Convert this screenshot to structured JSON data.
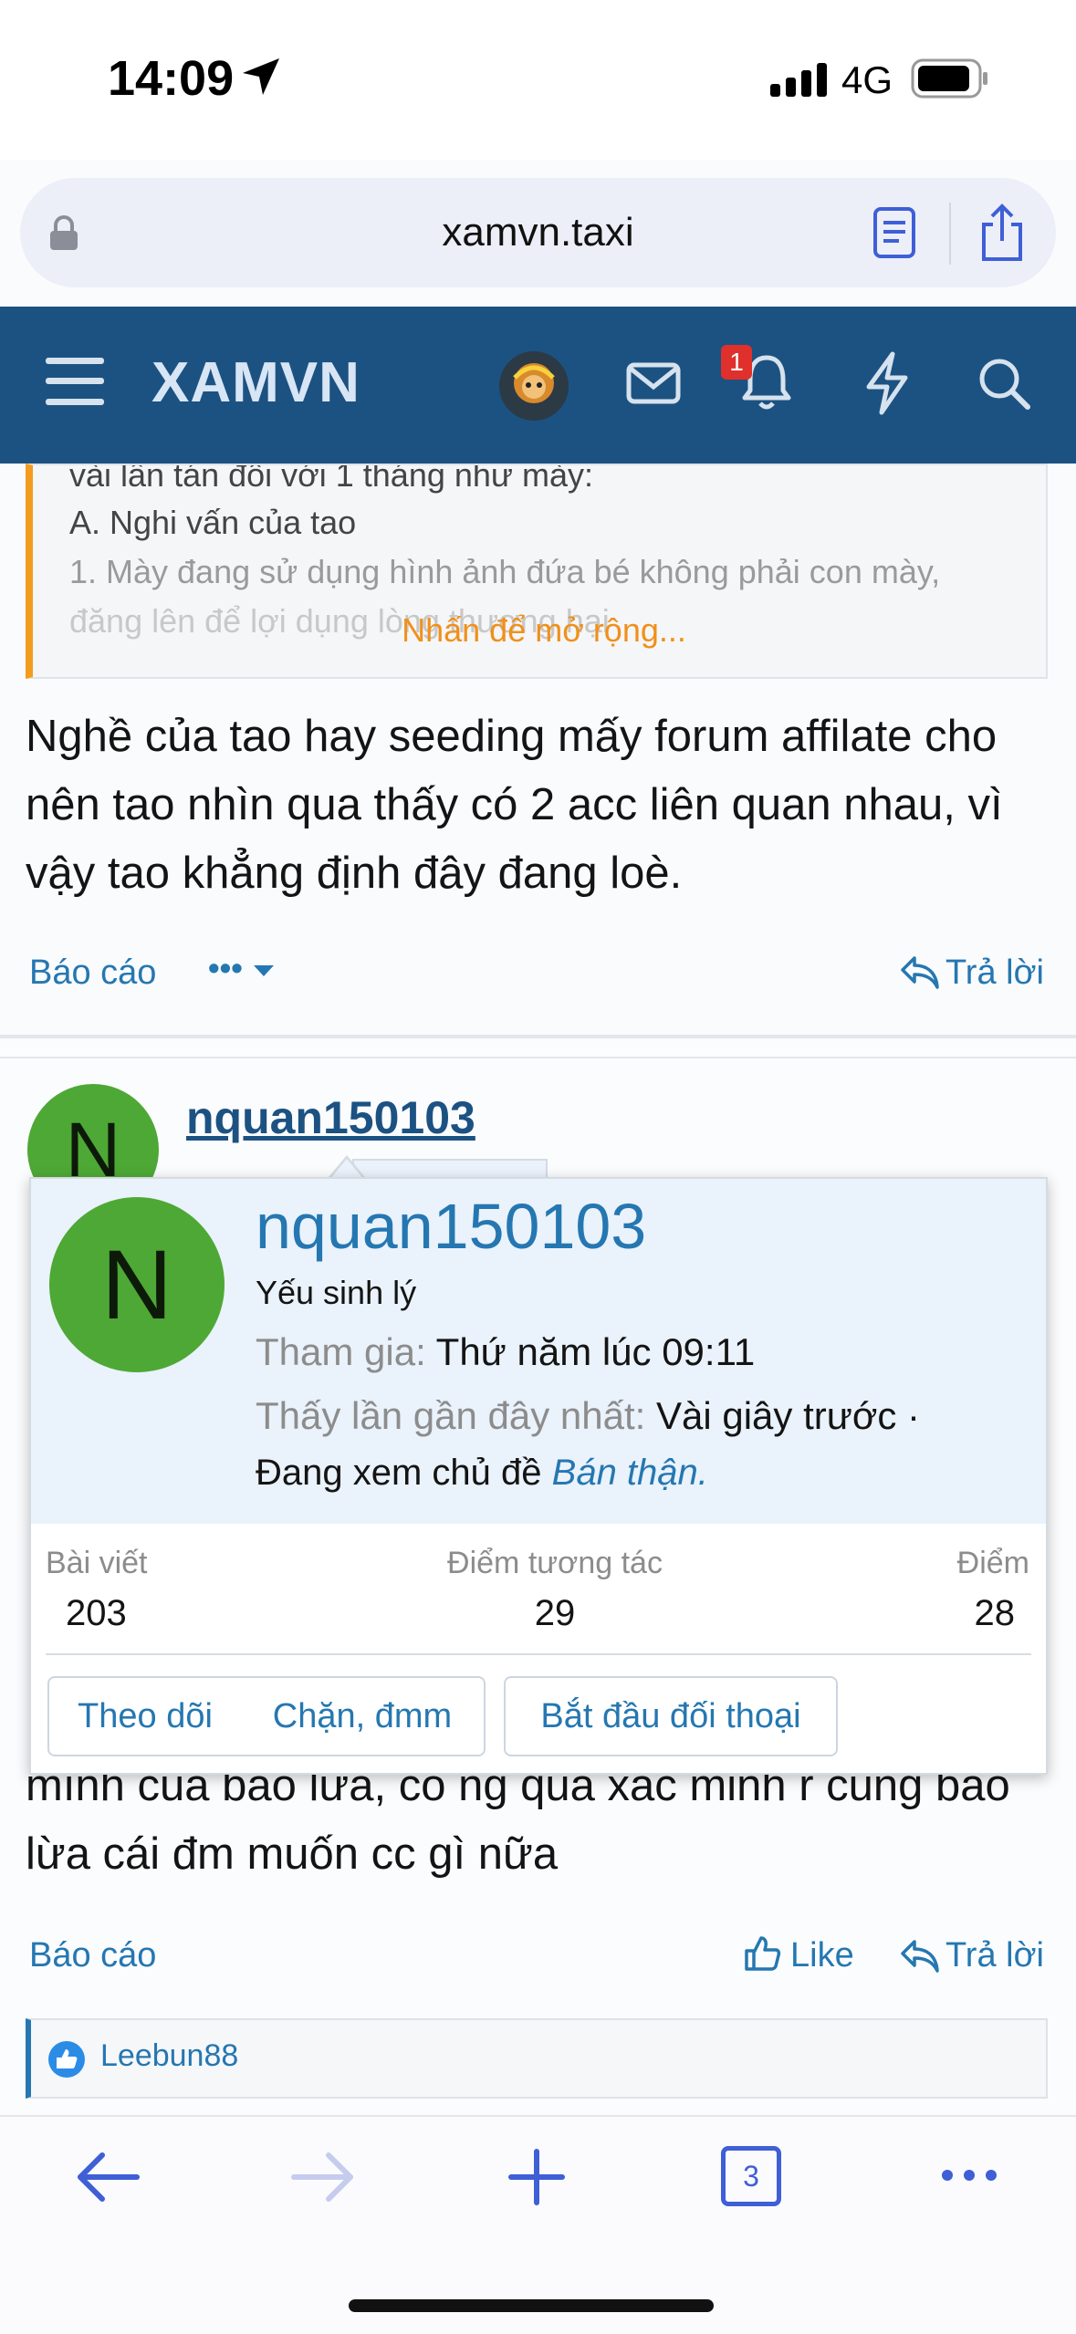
{
  "status_bar": {
    "time": "14:09",
    "network": "4G",
    "icons": [
      "location-arrow-icon",
      "signal-bars-icon",
      "battery-icon"
    ]
  },
  "browser": {
    "url": "xamvn.taxi",
    "icons": [
      "lock-icon",
      "reader-icon",
      "share-icon"
    ]
  },
  "forum_header": {
    "brand": "XAMVN",
    "notification_count": "1",
    "icons": [
      "menu-icon",
      "avatar",
      "mail-icon",
      "bell-icon",
      "bolt-icon",
      "search-icon"
    ]
  },
  "quote": {
    "lines": [
      "vài lần tán đổi với 1 tháng như mày:",
      "A. Nghi vấn của tao",
      "1. Mày đang sử dụng hình ảnh đứa bé không phải con mày,",
      "đăng lên để lợi dụng lòng thương hại"
    ],
    "expand_label": "Nhấn để mở rộng..."
  },
  "post1": {
    "text": "Nghề của tao hay seeding mấy forum affilate cho nên tao nhìn qua thấy có 2 acc liên quan nhau, vì vậy tao khẳng định đây đang loè.",
    "report_label": "Báo cáo",
    "more_label": "•••",
    "reply_label": "Trả lời"
  },
  "post2": {
    "avatar_letter": "N",
    "username": "nquan150103",
    "text": "mình của bảo lừa, có ng qua xác minh r cũng bảo lừa cái đm muốn cc gì nữa",
    "report_label": "Báo cáo",
    "like_label": "Like",
    "reply_label": "Trả lời",
    "liked_by": "Leebun88"
  },
  "member_card": {
    "avatar_letter": "N",
    "name": "nquan150103",
    "user_title": "Yếu sinh lý",
    "joined_label": "Tham gia:",
    "joined_value": "Thứ năm lúc 09:11",
    "last_seen_label": "Thấy lần gần đây nhất:",
    "last_seen_value": "Vài giây trước ·",
    "viewing_prefix": "Đang xem chủ đề",
    "viewing_thread": "Bán thận.",
    "stats": [
      {
        "label": "Bài viết",
        "value": "203"
      },
      {
        "label": "Điểm tương tác",
        "value": "29"
      },
      {
        "label": "Điểm",
        "value": "28"
      }
    ],
    "buttons": {
      "follow": "Theo dõi",
      "block": "Chặn, đmm",
      "start_conversation": "Bắt đầu đối thoại"
    }
  },
  "toolbar": {
    "tab_count": "3",
    "icons": [
      "back-arrow-icon",
      "forward-arrow-icon",
      "plus-icon",
      "tabs-icon",
      "more-icon"
    ]
  },
  "colors": {
    "header_bg": "#1c5282",
    "link": "#2577b1",
    "quote_accent": "#f39c1e",
    "avatar_green": "#4ea835",
    "badge_red": "#e0302b",
    "safari_blue": "#3f5fd6"
  }
}
